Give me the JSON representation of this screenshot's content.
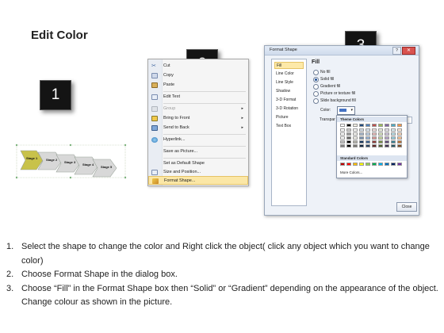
{
  "title": "Edit Color",
  "badges": [
    "1",
    "2",
    "3"
  ],
  "shapes": [
    "Stage 1",
    "Stage 2",
    "Stage 3",
    "Stage 4",
    "Stage 5"
  ],
  "context_menu": {
    "items": [
      {
        "label": "Cut",
        "icon": "scissors-icon",
        "enabled": true,
        "submenu": false
      },
      {
        "label": "Copy",
        "icon": "copy-icon",
        "enabled": true,
        "submenu": false
      },
      {
        "label": "Paste",
        "icon": "paste-icon",
        "enabled": true,
        "submenu": false
      },
      {
        "label": "Edit Text",
        "icon": "edit-text-icon",
        "enabled": true,
        "submenu": false
      },
      {
        "label": "Group",
        "icon": "group-icon",
        "enabled": false,
        "submenu": true
      },
      {
        "label": "Bring to Front",
        "icon": "bring-front-icon",
        "enabled": true,
        "submenu": true
      },
      {
        "label": "Send to Back",
        "icon": "send-back-icon",
        "enabled": true,
        "submenu": true
      },
      {
        "label": "Hyperlink...",
        "icon": "hyperlink-icon",
        "enabled": true,
        "submenu": false
      },
      {
        "label": "Save as Picture...",
        "icon": "",
        "enabled": true,
        "submenu": false
      },
      {
        "label": "Set as Default Shape",
        "icon": "",
        "enabled": true,
        "submenu": false
      },
      {
        "label": "Size and Position...",
        "icon": "size-icon",
        "enabled": true,
        "submenu": false
      },
      {
        "label": "Format Shape...",
        "icon": "format-shape-icon",
        "enabled": true,
        "submenu": false,
        "highlighted": true
      }
    ]
  },
  "dialog": {
    "title": "Format Shape",
    "help": "?",
    "close_glyph": "✕",
    "categories": [
      "Fill",
      "Line Color",
      "Line Style",
      "Shadow",
      "3-D Format",
      "3-D Rotation",
      "Picture",
      "Text Box"
    ],
    "selected_category": "Fill",
    "section_heading": "Fill",
    "fill_options": [
      "No fill",
      "Solid fill",
      "Gradient fill",
      "Picture or texture fill",
      "Slide background fill"
    ],
    "selected_fill": "Solid fill",
    "color_label": "Color:",
    "transparency_label": "Transpar",
    "theme_colors_label": "Theme Colors",
    "standard_colors_label": "Standard Colors",
    "more_colors_label": "More Colors...",
    "close_button": "Close",
    "theme_top_row": [
      "#ffffff",
      "#000000",
      "#eeece1",
      "#1f497d",
      "#4f81bd",
      "#c0504d",
      "#9bbb59",
      "#8064a2",
      "#4bacc6",
      "#f79646"
    ],
    "standard_colors": [
      "#c00000",
      "#ff0000",
      "#ffc000",
      "#ffff00",
      "#92d050",
      "#00b050",
      "#00b0f0",
      "#0070c0",
      "#002060",
      "#7030a0"
    ]
  },
  "steps": [
    "Select the shape to change the color and Right click the object( click any object which you want to change color)",
    "Choose Format Shape in the dialog box.",
    "Choose “Fill” in the Format Shape box then “Solid” or “Gradient” depending on the appearance of the object. Change colour as shown in the picture."
  ]
}
